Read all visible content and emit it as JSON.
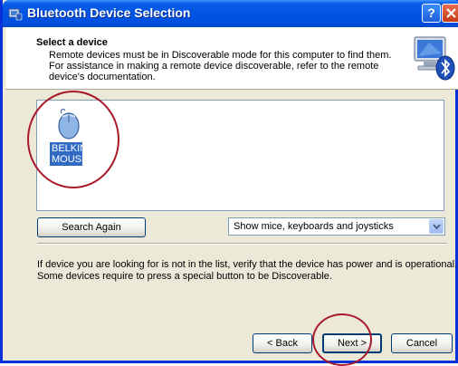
{
  "window": {
    "title": "Bluetooth Device Selection"
  },
  "header": {
    "title": "Select a device",
    "desc_lines": [
      "Remote devices must be in Discoverable mode for this computer to find them.",
      "For assistance in making a remote device discoverable, refer to the remote",
      "device's documentation."
    ]
  },
  "device_list": {
    "items": [
      {
        "label_lines": [
          "BELKIN",
          "MOUSE"
        ],
        "icon": "mouse-icon",
        "selected": true
      }
    ]
  },
  "controls": {
    "search_again_label": "Search Again",
    "filter_selected": "Show mice, keyboards and joysticks"
  },
  "info_lines": [
    "If device you are looking for is not in the list, verify that the device has power and is operational.",
    "Some devices require to press a special button to be Discoverable."
  ],
  "footer": {
    "back_label": "< Back",
    "next_label": "Next >",
    "cancel_label": "Cancel"
  },
  "colors": {
    "titlebar": "#0054e3",
    "selection": "#316ac5",
    "annotation_circle": "#a8192a"
  }
}
